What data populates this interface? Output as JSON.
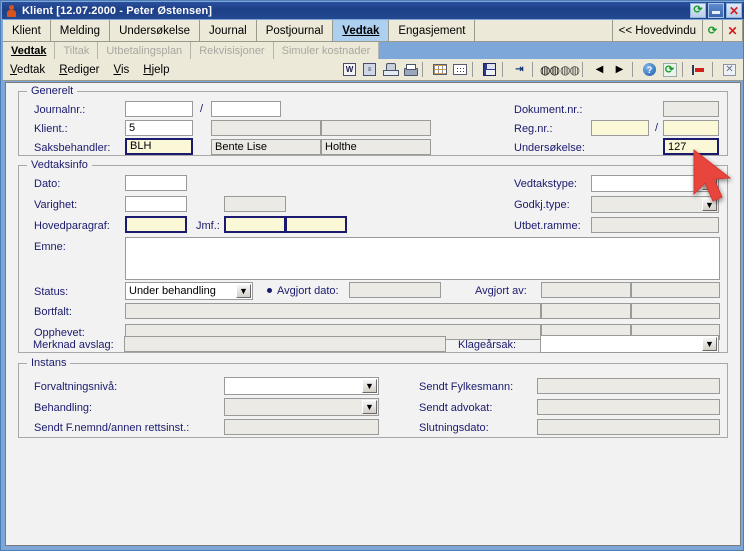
{
  "window": {
    "title": "Klient [12.07.2000 - Peter Østensen]",
    "icon": "person-icon",
    "buttons": {
      "refresh": "⟳",
      "minimize": "_",
      "close": "✕"
    }
  },
  "main_tabs": {
    "items": [
      {
        "label": "Klient",
        "active": false
      },
      {
        "label": "Melding",
        "active": false
      },
      {
        "label": "Undersøkelse",
        "active": false
      },
      {
        "label": "Journal",
        "active": false
      },
      {
        "label": "Postjournal",
        "active": false
      },
      {
        "label": "Vedtak",
        "active": true
      },
      {
        "label": "Engasjement",
        "active": false
      }
    ],
    "hovedvindu_label": "<< Hovedvindu",
    "refresh": "⟳",
    "close": "✕"
  },
  "sub_tabs": {
    "items": [
      {
        "label": "Vedtak",
        "active": true,
        "enabled": true
      },
      {
        "label": "Tiltak",
        "active": false,
        "enabled": false
      },
      {
        "label": "Utbetalingsplan",
        "active": false,
        "enabled": false
      },
      {
        "label": "Rekvisisjoner",
        "active": false,
        "enabled": false
      },
      {
        "label": "Simuler kostnader",
        "active": false,
        "enabled": false
      }
    ]
  },
  "menu": {
    "items": [
      {
        "accel": "V",
        "rest": "edtak"
      },
      {
        "accel": "R",
        "rest": "ediger"
      },
      {
        "accel": "V",
        "rest": "is"
      },
      {
        "accel": "H",
        "rest": "jelp"
      }
    ]
  },
  "toolbar": {
    "icons": [
      "word-export-icon",
      "document-template-icon",
      "stamp-icon",
      "print-icon",
      "table-view-icon",
      "detail-view-icon",
      "save-icon",
      "indent-icon",
      "find-icon",
      "find-next-icon",
      "previous-record-icon",
      "next-record-icon",
      "help-icon",
      "refresh-icon",
      "exit-icon",
      "close-icon"
    ]
  },
  "generelt": {
    "legend": "Generelt",
    "journalnr_label": "Journalnr.:",
    "journalnr_value": "",
    "journalnr_sep": "/",
    "journalnr_value2": "",
    "klient_label": "Klient.:",
    "klient_value": "5",
    "klient_name1": "",
    "klient_name2": "",
    "saksbehandler_label": "Saksbehandler:",
    "saksbehandler_code": "BLH",
    "saksbehandler_first": "Bente Lise",
    "saksbehandler_last": "Holthe",
    "dokumentnr_label": "Dokument.nr.:",
    "dokumentnr_value": "",
    "regnr_label": "Reg.nr.:",
    "regnr_value": "",
    "regnr_sep": "/",
    "regnr_value2": "",
    "undersokelse_label": "Undersøkelse:",
    "undersokelse_value": "127"
  },
  "vedtaksinfo": {
    "legend": "Vedtaksinfo",
    "dato_label": "Dato:",
    "dato_value": "",
    "varighet_label": "Varighet:",
    "varighet_value": "",
    "varighet_value2": "",
    "hovedparagraf_label": "Hovedparagraf:",
    "hovedparagraf_value": "",
    "jmf_label": "Jmf.:",
    "jmf_value": "",
    "jmf_value2": "",
    "emne_label": "Emne:",
    "emne_value": "",
    "vedtakstype_label": "Vedtakstype:",
    "vedtakstype_value": "",
    "godkjtype_label": "Godkj.type:",
    "godkjtype_value": "",
    "utbetramme_label": "Utbet.ramme:",
    "utbetramme_value": "",
    "status_label": "Status:",
    "status_value": "Under behandling",
    "avgjort_dato_label": "Avgjort dato:",
    "avgjort_dato_value": "",
    "avgjort_av_label": "Avgjort av:",
    "avgjort_av_value": "",
    "avgjort_av_value2": "",
    "bortfalt_label": "Bortfalt:",
    "bortfalt_value": "",
    "bortfalt_value2": "",
    "bortfalt_value3": "",
    "opphevet_label": "Opphevet:",
    "opphevet_value": "",
    "opphevet_value2": "",
    "opphevet_value3": "",
    "merknad_label": "Merknad avslag:",
    "merknad_value": "",
    "klagearsak_label": "Klageårsak:",
    "klagearsak_value": ""
  },
  "instans": {
    "legend": "Instans",
    "forvaltningsniva_label": "Forvaltningsnivå:",
    "forvaltningsniva_value": "",
    "behandling_label": "Behandling:",
    "behandling_value": "",
    "sendt_fnemnd_label": "Sendt F.nemnd/annen rettsinst.:",
    "sendt_fnemnd_value": "",
    "sendt_fylkesmann_label": "Sendt Fylkesmann:",
    "sendt_fylkesmann_value": "",
    "sendt_advokat_label": "Sendt advokat:",
    "sendt_advokat_value": "",
    "slutningsdato_label": "Slutningsdato:",
    "slutningsdato_value": ""
  },
  "cursor": {
    "name": "mouse-pointer-arrow",
    "color": "#e8453c"
  },
  "colors": {
    "titlebar": "#1d3f88",
    "tab_active": "#aed0f0",
    "field_yellow": "#fbf8d8",
    "label_text": "#1a1a6e",
    "window_frame": "#7da7d9"
  }
}
